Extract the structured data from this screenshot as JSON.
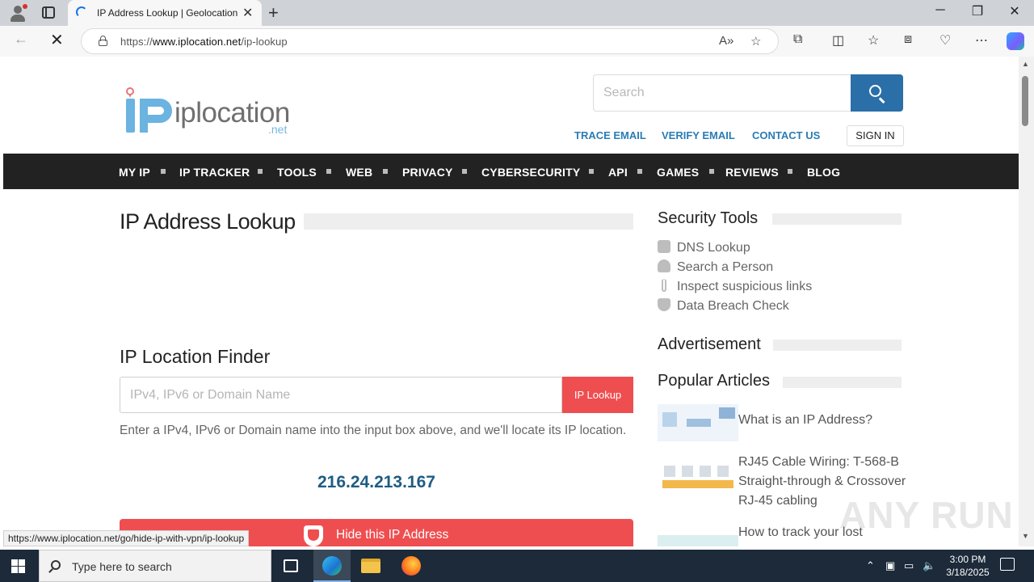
{
  "browser": {
    "tab_title": "IP Address Lookup | Geolocation",
    "url_prefix": "https://",
    "url_host": "www.iplocation.net",
    "url_path": "/ip-lookup",
    "status_url": "https://www.iplocation.net/go/hide-ip-with-vpn/ip-lookup"
  },
  "site": {
    "logo_word": "iplocation",
    "logo_tld": ".net",
    "search_placeholder": "Search",
    "top_links": [
      "TRACE EMAIL",
      "VERIFY EMAIL",
      "CONTACT US"
    ],
    "sign_in": "SIGN IN",
    "nav": [
      "MY IP",
      "IP TRACKER",
      "TOOLS",
      "WEB",
      "PRIVACY",
      "CYBERSECURITY",
      "API",
      "GAMES",
      "REVIEWS",
      "BLOG"
    ]
  },
  "main": {
    "title": "IP Address Lookup",
    "finder_title": "IP Location Finder",
    "input_placeholder": "IPv4, IPv6 or Domain Name",
    "lookup_button": "IP Lookup",
    "hint": "Enter a IPv4, IPv6 or Domain name into the input box above, and we'll locate its IP location.",
    "ip_address": "216.24.213.167",
    "hide_button": "Hide this IP Address"
  },
  "sidebar": {
    "security_title": "Security Tools",
    "tools": [
      "DNS Lookup",
      "Search a Person",
      "Inspect suspicious links",
      "Data Breach Check"
    ],
    "ad_title": "Advertisement",
    "popular_title": "Popular Articles",
    "articles": [
      "What is an IP Address?",
      "RJ45 Cable Wiring: T-568-B Straight-through & Crossover RJ-45 cabling",
      "How to track your lost"
    ]
  },
  "watermark": "ANY RUN",
  "taskbar": {
    "search_text": "Type here to search",
    "time": "3:00 PM",
    "date": "3/18/2025"
  }
}
